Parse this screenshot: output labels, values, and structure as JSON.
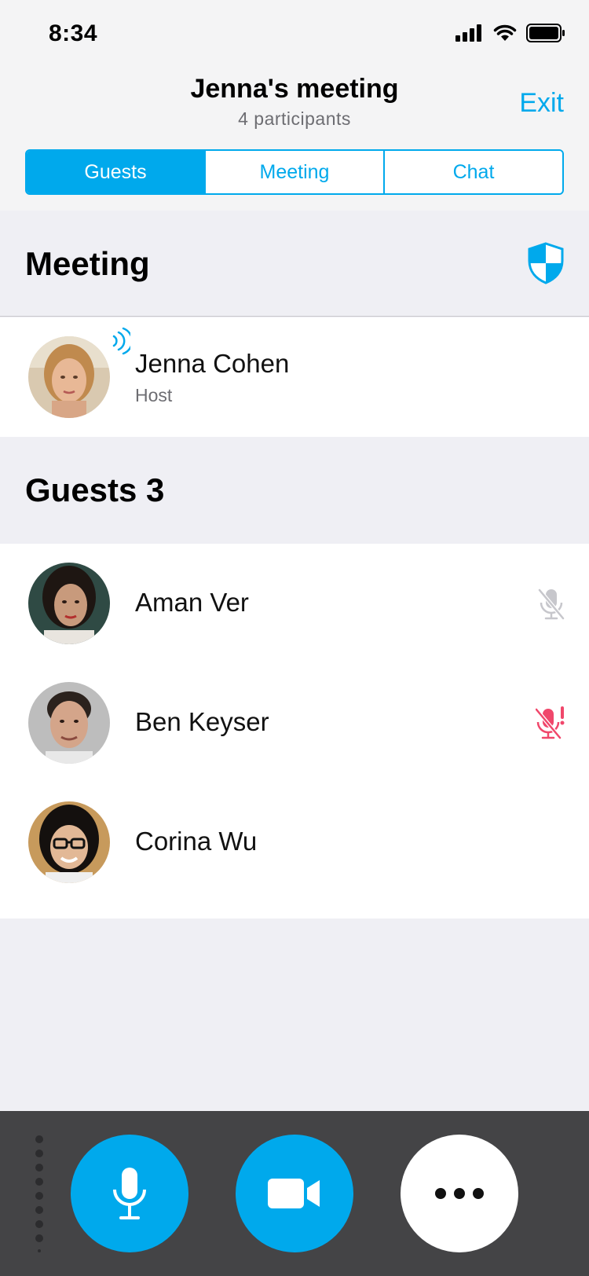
{
  "status": {
    "time": "8:34"
  },
  "header": {
    "title": "Jenna's meeting",
    "participants": "4 participants",
    "exit_label": "Exit"
  },
  "tabs": [
    {
      "label": "Guests",
      "active": true
    },
    {
      "label": "Meeting",
      "active": false
    },
    {
      "label": "Chat",
      "active": false
    }
  ],
  "sections": {
    "meeting": {
      "title": "Meeting",
      "icon": "shield-icon",
      "host": {
        "name": "Jenna Cohen",
        "role": "Host",
        "speaking": true
      }
    },
    "guests": {
      "title": "Guests 3",
      "items": [
        {
          "name": "Aman Ver",
          "status_icon": "mic-muted-icon"
        },
        {
          "name": "Ben Keyser",
          "status_icon": "mic-muted-alert-icon"
        },
        {
          "name": "Corina Wu",
          "status_icon": ""
        }
      ]
    }
  },
  "controls": [
    {
      "name": "microphone",
      "icon": "microphone-icon"
    },
    {
      "name": "camera",
      "icon": "video-camera-icon"
    },
    {
      "name": "more",
      "icon": "more-dots-icon"
    }
  ],
  "colors": {
    "accent": "#00a9ec",
    "alert": "#f0476b",
    "muted_icon": "#c7c7cc",
    "bottom_bar": "#444446"
  }
}
